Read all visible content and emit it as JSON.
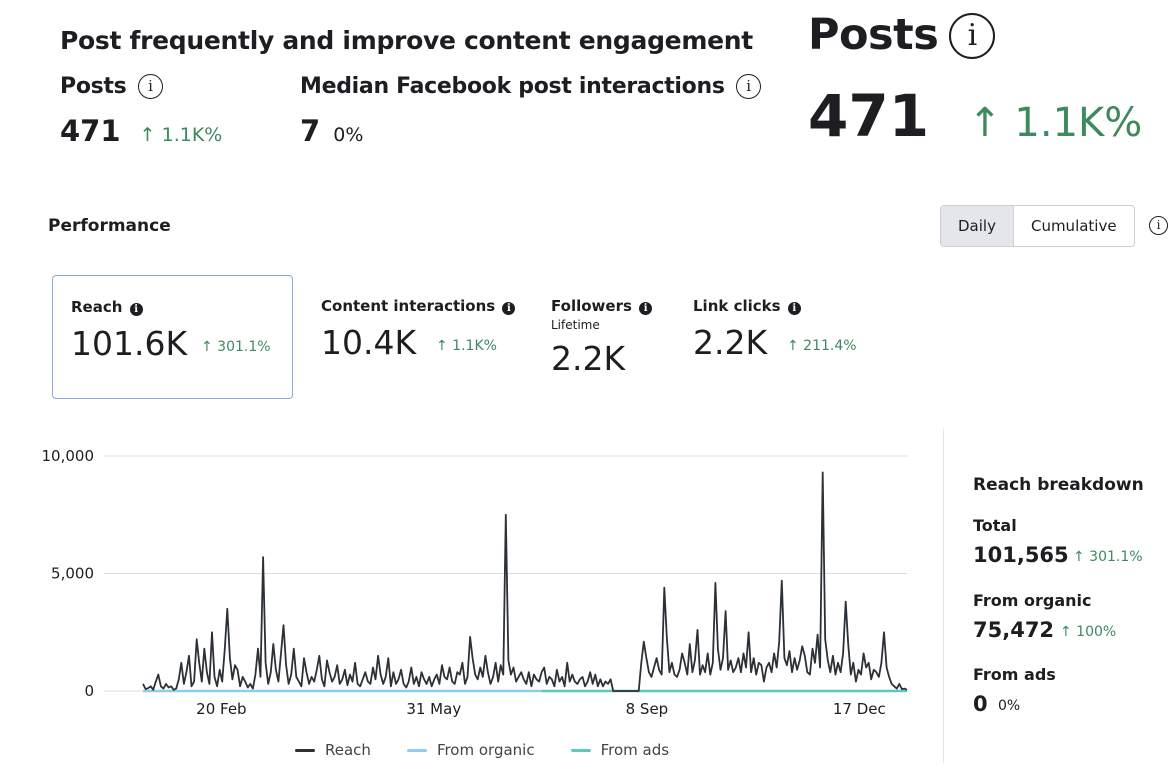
{
  "summary": {
    "headline": "Post frequently and improve content engagement",
    "posts_label": "Posts",
    "posts_value": "471",
    "posts_delta": "↑ 1.1K%",
    "median_label": "Median Facebook post interactions",
    "median_value": "7",
    "median_delta": "0%"
  },
  "zoom": {
    "posts_label": "Posts",
    "posts_value": "471",
    "posts_delta": "↑ 1.1K%"
  },
  "performance": {
    "title": "Performance",
    "toggle": [
      "Daily",
      "Cumulative"
    ],
    "selected_toggle": "Daily"
  },
  "metrics": [
    {
      "label": "Reach",
      "value": "101.6K",
      "delta": "↑ 301.1%",
      "selected": true
    },
    {
      "label": "Content interactions",
      "value": "10.4K",
      "delta": "↑ 1.1K%"
    },
    {
      "label": "Followers",
      "sublabel": "Lifetime",
      "value": "2.2K"
    },
    {
      "label": "Link clicks",
      "value": "2.2K",
      "delta": "↑ 211.4%"
    }
  ],
  "breakdown": {
    "title": "Reach breakdown",
    "total_label": "Total",
    "total_value": "101,565",
    "total_delta": "↑ 301.1%",
    "organic_label": "From organic",
    "organic_value": "75,472",
    "organic_delta": "↑ 100%",
    "ads_label": "From ads",
    "ads_value": "0",
    "ads_delta": "0%"
  },
  "colors": {
    "positive": "#3d8a5e",
    "reach": "#2b3137",
    "organic": "#8ecdf0",
    "ads": "#5ec8c3",
    "selected_border": "#8aa8d8"
  },
  "chart_data": {
    "type": "line",
    "ylim": [
      0,
      10000
    ],
    "y_ticks": [
      "10,000",
      "5,000",
      "0"
    ],
    "x_ticks": [
      "20 Feb",
      "31 May",
      "8 Sep",
      "17 Dec"
    ],
    "series": [
      {
        "name": "Reach",
        "values": [
          300,
          80,
          120,
          200,
          50,
          400,
          700,
          200,
          100,
          300,
          150,
          200,
          50,
          100,
          500,
          1200,
          300,
          800,
          1500,
          200,
          400,
          2200,
          1200,
          400,
          1800,
          800,
          300,
          2500,
          600,
          200,
          900,
          400,
          1800,
          3500,
          1400,
          500,
          1100,
          900,
          200,
          600,
          400,
          150,
          300,
          100,
          700,
          1800,
          600,
          5700,
          1200,
          300,
          800,
          2000,
          900,
          400,
          1600,
          2800,
          1100,
          300,
          700,
          1800,
          600,
          400,
          200,
          1400,
          800,
          300,
          600,
          400,
          900,
          1500,
          500,
          200,
          1300,
          800,
          400,
          600,
          1100,
          300,
          500,
          900,
          250,
          700,
          400,
          1200,
          300,
          200,
          500,
          800,
          400,
          300,
          1000,
          500,
          1500,
          700,
          300,
          600,
          1400,
          200,
          800,
          300,
          500,
          900,
          300,
          150,
          400,
          1000,
          300,
          600,
          200,
          800,
          500,
          300,
          600,
          200,
          500,
          700,
          300,
          1100,
          600,
          500,
          1000,
          400,
          300,
          800,
          700,
          1200,
          300,
          600,
          2300,
          1400,
          700,
          500,
          1000,
          600,
          1500,
          800,
          300,
          600,
          1200,
          400,
          1100,
          700,
          7500,
          1300,
          700,
          1000,
          400,
          600,
          800,
          500,
          300,
          800,
          200,
          700,
          500,
          400,
          800,
          1000,
          300,
          600,
          500,
          200,
          900,
          400,
          600,
          200,
          1200,
          400,
          700,
          400,
          300,
          500,
          600,
          200,
          400,
          800,
          300,
          700,
          200,
          500,
          200,
          400,
          300,
          500,
          0,
          0,
          0,
          0,
          0,
          0,
          0,
          0,
          0,
          0,
          0,
          1200,
          2100,
          1400,
          800,
          600,
          1000,
          1400,
          900,
          700,
          4400,
          2300,
          800,
          1200,
          700,
          600,
          900,
          1600,
          1200,
          700,
          2000,
          800,
          1300,
          2600,
          700,
          1100,
          800,
          1600,
          700,
          1200,
          4600,
          1800,
          900,
          1400,
          3400,
          900,
          1300,
          800,
          1000,
          1400,
          800,
          1600,
          1000,
          2500,
          800,
          1400,
          700,
          1200,
          1100,
          400,
          1000,
          1200,
          800,
          1600,
          1000,
          2100,
          4700,
          1400,
          1100,
          1700,
          800,
          1400,
          900,
          1300,
          1900,
          1500,
          800,
          700,
          1800,
          1200,
          2400,
          1000,
          9300,
          2200,
          1300,
          800,
          1500,
          700,
          1200,
          800,
          1600,
          3800,
          2000,
          700,
          1200,
          400,
          900,
          700,
          1600,
          1000,
          1200,
          500,
          900,
          800,
          600,
          1200,
          2500,
          1000,
          600,
          300,
          200,
          100,
          300,
          80,
          100,
          50
        ]
      },
      {
        "name": "From organic",
        "values": [
          0,
          0
        ]
      },
      {
        "name": "From ads",
        "values": [
          0,
          0
        ]
      }
    ]
  }
}
